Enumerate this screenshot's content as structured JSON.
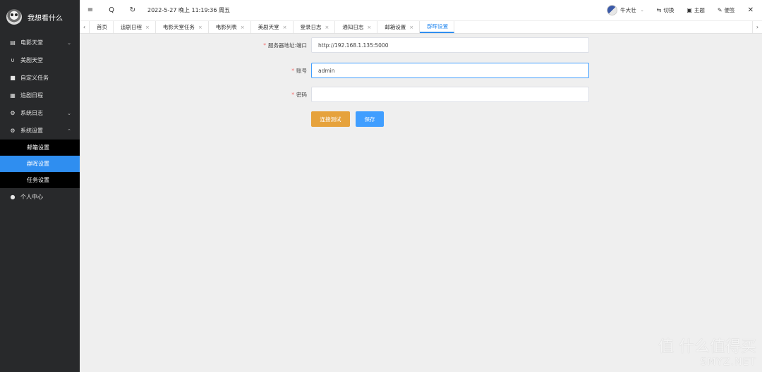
{
  "app": {
    "title": "我想看什么"
  },
  "sidebar": {
    "items": [
      {
        "label": "电影天堂",
        "icon": "film-icon",
        "expandable": true
      },
      {
        "label": "美剧天堂",
        "icon": "magnet-icon",
        "expandable": false
      },
      {
        "label": "自定义任务",
        "icon": "clipboard-icon",
        "expandable": false
      },
      {
        "label": "追剧日程",
        "icon": "calendar-icon",
        "expandable": false
      },
      {
        "label": "系统日志",
        "icon": "gear-icon",
        "expandable": true
      },
      {
        "label": "系统设置",
        "icon": "gear-icon",
        "expandable": true,
        "expanded": true
      }
    ],
    "sub_items": [
      {
        "label": "邮箱设置",
        "active": false
      },
      {
        "label": "群晖设置",
        "active": true
      },
      {
        "label": "任务设置",
        "active": false
      }
    ],
    "footer_item": {
      "label": "个人中心",
      "icon": "user-icon"
    }
  },
  "header": {
    "datetime": "2022-5-27 晚上 11:19:36 周五",
    "user": "牛大壮",
    "links": [
      {
        "label": "切换",
        "icon": "switch-icon"
      },
      {
        "label": "主题",
        "icon": "theme-icon"
      },
      {
        "label": "便签",
        "icon": "pen-icon"
      }
    ]
  },
  "tabs": [
    {
      "label": "首页",
      "closable": false
    },
    {
      "label": "追剧日程",
      "closable": true
    },
    {
      "label": "电影天堂任务",
      "closable": true
    },
    {
      "label": "电影列表",
      "closable": true
    },
    {
      "label": "美剧天堂",
      "closable": true
    },
    {
      "label": "登录日志",
      "closable": true
    },
    {
      "label": "通知日志",
      "closable": true
    },
    {
      "label": "邮箱设置",
      "closable": true
    },
    {
      "label": "群晖设置",
      "closable": false,
      "active": true
    }
  ],
  "form": {
    "server": {
      "label": "服务器地址:端口",
      "value": "http://192.168.1.135:5000"
    },
    "account": {
      "label": "账号",
      "value": "admin"
    },
    "password": {
      "label": "密码",
      "value": ""
    },
    "test_button": "连接测试",
    "save_button": "保存"
  },
  "watermark": {
    "line1": "值 什么值得买",
    "line2": "SMYZ.NET"
  },
  "colors": {
    "sidebar_bg": "#28292b",
    "accent": "#2f8ef0",
    "warning": "#e6a23c",
    "primary": "#409eff",
    "required": "#f56c6c"
  }
}
